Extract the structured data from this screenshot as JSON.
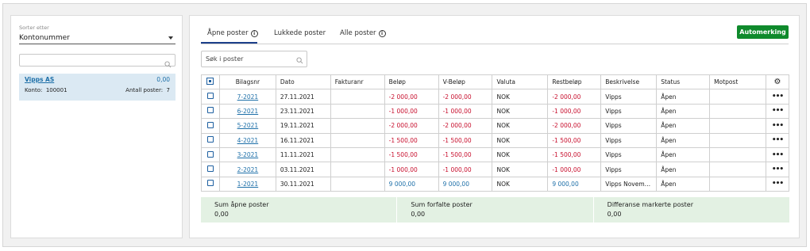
{
  "sidebar": {
    "sort_label": "Sorter etter",
    "sort_value": "Kontonummer",
    "search_placeholder": "",
    "account": {
      "name": "Vipps AS",
      "amount": "0,00",
      "konto_label": "Konto:",
      "konto_value": "100001",
      "antall_label": "Antall poster:",
      "antall_value": "7"
    }
  },
  "tabs": [
    {
      "label": "Åpne poster",
      "active": true
    },
    {
      "label": "Lukkede poster",
      "active": false
    },
    {
      "label": "Alle poster",
      "active": false
    }
  ],
  "automerking_label": "Automerking",
  "search_placeholder": "Søk i poster",
  "table": {
    "headers": [
      "Bilagsnr",
      "Dato",
      "Fakturanr",
      "Beløp",
      "V-Beløp",
      "Valuta",
      "Restbeløp",
      "Beskrivelse",
      "Status",
      "Motpost"
    ],
    "rows": [
      {
        "bilagsnr": "7-2021",
        "dato": "27.11.2021",
        "fakturanr": "",
        "belop": "-2 000,00",
        "vbelop": "-2 000,00",
        "valuta": "NOK",
        "restbelop": "-2 000,00",
        "beskrivelse": "Vipps",
        "status": "Åpen",
        "motpost": ""
      },
      {
        "bilagsnr": "6-2021",
        "dato": "23.11.2021",
        "fakturanr": "",
        "belop": "-1 000,00",
        "vbelop": "-1 000,00",
        "valuta": "NOK",
        "restbelop": "-1 000,00",
        "beskrivelse": "Vipps",
        "status": "Åpen",
        "motpost": ""
      },
      {
        "bilagsnr": "5-2021",
        "dato": "19.11.2021",
        "fakturanr": "",
        "belop": "-2 000,00",
        "vbelop": "-2 000,00",
        "valuta": "NOK",
        "restbelop": "-2 000,00",
        "beskrivelse": "Vipps",
        "status": "Åpen",
        "motpost": ""
      },
      {
        "bilagsnr": "4-2021",
        "dato": "16.11.2021",
        "fakturanr": "",
        "belop": "-1 500,00",
        "vbelop": "-1 500,00",
        "valuta": "NOK",
        "restbelop": "-1 500,00",
        "beskrivelse": "Vipps",
        "status": "Åpen",
        "motpost": ""
      },
      {
        "bilagsnr": "3-2021",
        "dato": "11.11.2021",
        "fakturanr": "",
        "belop": "-1 500,00",
        "vbelop": "-1 500,00",
        "valuta": "NOK",
        "restbelop": "-1 500,00",
        "beskrivelse": "Vipps",
        "status": "Åpen",
        "motpost": ""
      },
      {
        "bilagsnr": "2-2021",
        "dato": "03.11.2021",
        "fakturanr": "",
        "belop": "-1 000,00",
        "vbelop": "-1 000,00",
        "valuta": "NOK",
        "restbelop": "-1 000,00",
        "beskrivelse": "Vipps",
        "status": "Åpen",
        "motpost": ""
      },
      {
        "bilagsnr": "1-2021",
        "dato": "30.11.2021",
        "fakturanr": "",
        "belop": "9 000,00",
        "vbelop": "9 000,00",
        "valuta": "NOK",
        "restbelop": "9 000,00",
        "beskrivelse": "Vipps Novem…",
        "status": "Åpen",
        "motpost": ""
      }
    ],
    "row_menu": "•••"
  },
  "summary": [
    {
      "label": "Sum åpne poster",
      "value": "0,00"
    },
    {
      "label": "Sum forfalte poster",
      "value": "0,00"
    },
    {
      "label": "Differanse markerte poster",
      "value": "0,00"
    }
  ],
  "colors": {
    "accent": "#1c3f8a",
    "button": "#0f8a2c",
    "negative": "#c8102e",
    "positive": "#1d6fa8",
    "summary_bg": "#e3f1e3"
  }
}
